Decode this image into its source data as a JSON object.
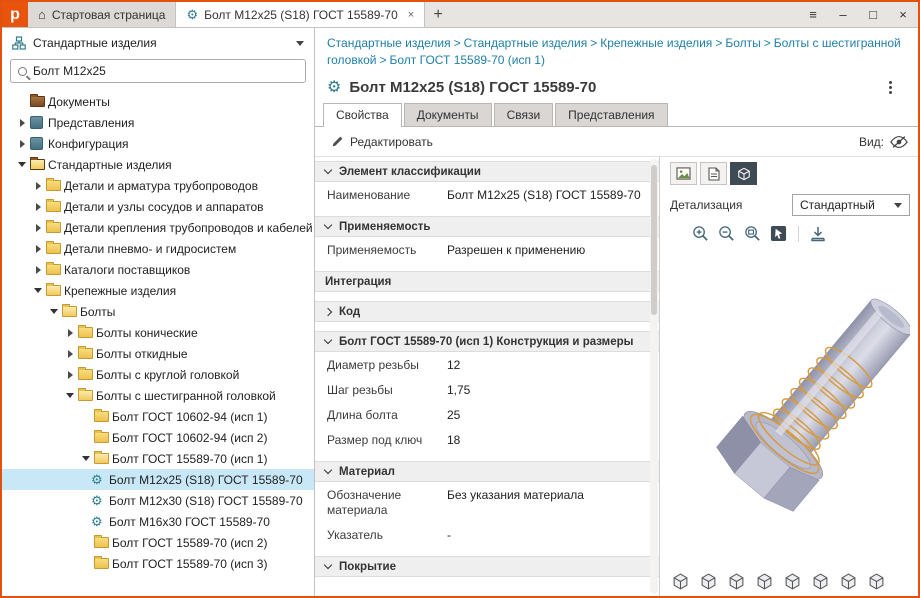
{
  "icons": {
    "app_logo_letter": "p",
    "home": "⌂",
    "part": "⚙",
    "menu": "≡",
    "minimize": "–",
    "maximize": "□",
    "close": "×",
    "tab_close": "×",
    "new_tab": "+"
  },
  "titlebar": {
    "tabs": [
      {
        "label": "Стартовая страница"
      },
      {
        "label": "Болт М12х25 (S18) ГОСТ 15589-70"
      }
    ]
  },
  "sidebar": {
    "mode_title": "Стандартные изделия",
    "search_value": "Болт М12х25",
    "tree": [
      "Документы",
      "Представления",
      "Конфигурация",
      "Стандартные изделия",
      "Детали и арматура трубопроводов",
      "Детали и узлы сосудов и аппаратов",
      "Детали крепления трубопроводов и кабелей",
      "Детали пневмо- и гидросистем",
      "Каталоги поставщиков",
      "Крепежные изделия",
      "Болты",
      "Болты конические",
      "Болты откидные",
      "Болты с круглой головкой",
      "Болты с шестигранной головкой",
      "Болт ГОСТ 10602-94 (исп 1)",
      "Болт ГОСТ 10602-94 (исп 2)",
      "Болт ГОСТ 15589-70 (исп 1)",
      "Болт М12х25 (S18) ГОСТ 15589-70",
      "Болт М12х30 (S18) ГОСТ 15589-70",
      "Болт М16х30 ГОСТ 15589-70",
      "Болт ГОСТ 15589-70 (исп 2)",
      "Болт ГОСТ 15589-70 (исп 3)"
    ]
  },
  "main": {
    "breadcrumb": {
      "sep": ">",
      "items": [
        "Стандартные изделия",
        "Стандартные изделия",
        "Крепежные изделия",
        "Болты",
        "Болты с шестигранной головкой",
        "Болт ГОСТ 15589-70 (исп 1)"
      ]
    },
    "title": "Болт М12х25 (S18) ГОСТ 15589-70",
    "tabs": [
      "Свойства",
      "Документы",
      "Связи",
      "Представления"
    ],
    "toolbar": {
      "edit_label": "Редактировать",
      "view_label": "Вид:"
    },
    "properties": {
      "sections": [
        {
          "title": "Элемент классификации",
          "rows": [
            {
              "name": "Наименование",
              "value": "Болт М12х25 (S18) ГОСТ 15589-70"
            }
          ]
        },
        {
          "title": "Применяемость",
          "rows": [
            {
              "name": "Применяемость",
              "value": "Разрешен к применению"
            }
          ]
        },
        {
          "title": "Интеграция",
          "rows": []
        },
        {
          "title": "Код",
          "rows": []
        },
        {
          "title": "Болт ГОСТ 15589-70 (исп 1) Конструкция и размеры",
          "rows": [
            {
              "name": "Диаметр резьбы",
              "value": "12"
            },
            {
              "name": "Шаг резьбы",
              "value": "1,75"
            },
            {
              "name": "Длина болта",
              "value": "25"
            },
            {
              "name": "Размер под ключ",
              "value": "18"
            }
          ]
        },
        {
          "title": "Материал",
          "rows": [
            {
              "name": "Обозначение материала",
              "value": "Без указания материала"
            },
            {
              "name": "Указатель",
              "value": "-"
            }
          ]
        },
        {
          "title": "Покрытие",
          "rows": []
        }
      ]
    },
    "preview": {
      "detail_label": "Детализация",
      "detail_value": "Стандартный"
    }
  }
}
